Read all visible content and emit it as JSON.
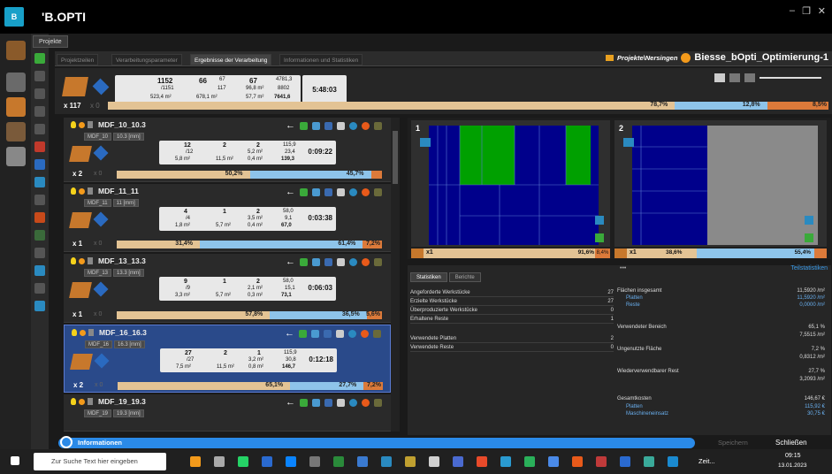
{
  "app": {
    "logo": "B",
    "title": "'B.OPTI"
  },
  "window": {
    "minimize": "–",
    "restore": "❐",
    "close": "✕"
  },
  "project_tab": "Projekte",
  "tabs": [
    "Projektzeilen",
    "Verarbeitungsparameter",
    "Ergebnisse der Verarbeitung",
    "Informationen und Statistiken"
  ],
  "breadcrumb": {
    "path": "Projekte\\Nersingen",
    "name": "Biesse_bOpti_Optimierung-1"
  },
  "summary": {
    "count": "x 117",
    "count2": "x 0",
    "box1": {
      "a": "1152",
      "b": "/1151",
      "c": "523,4 m²"
    },
    "box2": {
      "a": "66",
      "b": "67",
      "c": "117",
      "d": "678,1 m²"
    },
    "box3": {
      "a": "67",
      "b": "96,8 m²",
      "c": "57,7 m²"
    },
    "box4": {
      "a": "4781,3",
      "b": "8802",
      "c": "7641,6"
    },
    "time": "5:48:03",
    "pct1": "78,7%",
    "pct2": "12,8%",
    "pct3": "8,5%",
    "fill_pct": [
      78.7,
      12.8,
      8.5
    ]
  },
  "groups": [
    {
      "name": "MDF_10_10.3",
      "mat": "MDF_10",
      "thick": "10.3 [mm]",
      "count": "x 2",
      "count2": "x 0",
      "parts": "12",
      "parts2": "/12",
      "area1": "5,8 m²",
      "boards": "2",
      "area2": "11,5 m²",
      "rest": "2",
      "r1": "5,2 m²",
      "r2": "0,4 m²",
      "cost1": "115,9",
      "cost2": "23,4",
      "cost3": "139,3",
      "time": "0:09:22",
      "p1": "50,2%",
      "p2": "45,7%",
      "fill": [
        50.2,
        45.7,
        4.1
      ]
    },
    {
      "name": "MDF_11_11",
      "mat": "MDF_11",
      "thick": "11 [mm]",
      "count": "x 1",
      "count2": "x 0",
      "parts": "4",
      "parts2": "/4",
      "area1": "1,8 m²",
      "boards": "1",
      "area2": "5,7 m²",
      "rest": "2",
      "r1": "3,5 m²",
      "r2": "0,4 m²",
      "cost1": "58,0",
      "cost2": "9,1",
      "cost3": "67,0",
      "time": "0:03:38",
      "p1": "31,4%",
      "p2": "61,4%",
      "p3": "7,2%",
      "fill": [
        31.4,
        61.4,
        7.2
      ]
    },
    {
      "name": "MDF_13_13.3",
      "mat": "MDF_13",
      "thick": "13.3 [mm]",
      "count": "x 1",
      "count2": "x 0",
      "parts": "9",
      "parts2": "/9",
      "area1": "3,3 m²",
      "boards": "1",
      "area2": "5,7 m²",
      "rest": "2",
      "r1": "2,1 m²",
      "r2": "0,3 m²",
      "cost1": "58,0",
      "cost2": "15,1",
      "cost3": "73,1",
      "time": "0:06:03",
      "p1": "57,8%",
      "p2": "36,5%",
      "p3": "5,6%",
      "fill": [
        57.8,
        36.5,
        5.7
      ]
    },
    {
      "name": "MDF_16_16.3",
      "mat": "MDF_16",
      "thick": "16.3 [mm]",
      "count": "x 2",
      "count2": "x 0",
      "parts": "27",
      "parts2": "/27",
      "area1": "7,5 m²",
      "boards": "2",
      "area2": "11,5 m²",
      "rest": "1",
      "r1": "3,2 m²",
      "r2": "0,8 m²",
      "cost1": "115,9",
      "cost2": "30,8",
      "cost3": "146,7",
      "time": "0:12:18",
      "p1": "65,1%",
      "p2": "27,7%",
      "p3": "7,2%",
      "fill": [
        65.1,
        27.7,
        7.2
      ]
    },
    {
      "name": "MDF_19_19.3",
      "mat": "MDF_19",
      "thick": "19.3 [mm]"
    }
  ],
  "boards": [
    {
      "idx": "1",
      "count": "x1",
      "p1": "91,6%",
      "p2": "8,4%",
      "fill": [
        91.6,
        8.4
      ]
    },
    {
      "idx": "2",
      "count": "x1",
      "p1": "38,6%",
      "p2": "55,4%",
      "fill": [
        38.6,
        55.4,
        6.0
      ]
    }
  ],
  "stats": {
    "tabs": [
      "Statistiken",
      "Berichte"
    ],
    "teil_link": "Teilstatistiken",
    "dots": "•••",
    "left": [
      {
        "l": "Angeforderte Werkstücke",
        "v": "27"
      },
      {
        "l": "Erzielte Werkstücke",
        "v": "27"
      },
      {
        "l": "Überproduzierte Werkstücke",
        "v": "0"
      },
      {
        "l": "Erhaltene Reste",
        "v": "1"
      },
      {
        "l": "Verwendete Platten",
        "v": "2"
      },
      {
        "l": "Verwendete Reste",
        "v": "0"
      }
    ],
    "right": {
      "flaechen": "Flächen insgesamt",
      "flaechen_v": "11,5920 /m²",
      "platten": "Platten",
      "platten_v": "11,5920 /m²",
      "reste": "Reste",
      "reste_v": "0,0000 /m²",
      "bereich": "Verwendeter Bereich",
      "bereich_p": "65,1 %",
      "bereich_v": "7,5515 /m²",
      "ungenutzt": "Ungenutzte Fläche",
      "ungenutzt_p": "7,2 %",
      "ungenutzt_v": "0,8312 /m²",
      "rest": "Wiederverwendbarer Rest",
      "rest_p": "27,7 %",
      "rest_v": "3,2093 /m²",
      "gesamt": "Gesamtkosten",
      "gesamt_v": "146,67 €",
      "gplatten": "Platten",
      "gplatten_v": "115,92 €",
      "masch": "Maschineneinsatz",
      "masch_v": "30,75 €"
    }
  },
  "info": {
    "label": "Informationen",
    "save": "Speichern",
    "close": "Schließen"
  },
  "taskbar": {
    "search": "Zur Suche Text hier eingeben",
    "zeit": "Zeit...",
    "time": "09:15",
    "date": "13.01.2023"
  },
  "colors": {
    "accent": "#18a0c8",
    "orange": "#f39a1b",
    "progress": "#e3c394",
    "blue_bar": "#8ec4ea",
    "board_blue": "#00008b",
    "board_green": "#00a000"
  }
}
